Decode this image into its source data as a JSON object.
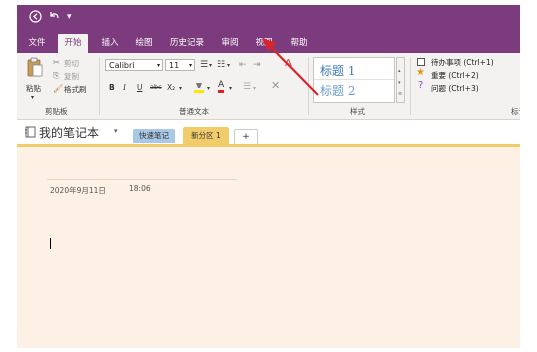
{
  "titlebar": {
    "back_icon": "back-circle-icon",
    "undo_icon": "undo-icon",
    "customize_icon": "customize-toolbar-icon"
  },
  "tabs": [
    "文件",
    "开始",
    "插入",
    "绘图",
    "历史记录",
    "审阅",
    "视图",
    "帮助"
  ],
  "active_tab": "开始",
  "clipboard": {
    "paste": "粘贴",
    "cut": "剪切",
    "copy": "复制",
    "format_painter": "格式刷",
    "group_label": "剪贴板"
  },
  "basic_text": {
    "font": "Calibri",
    "size": "11",
    "bold": "B",
    "italic": "I",
    "underline": "U",
    "strikethrough": "abc",
    "subscript": "X₂",
    "font_color": "A",
    "group_label": "普通文本"
  },
  "styles": {
    "heading1": "标题 1",
    "heading2": "标题 2",
    "group_label": "样式"
  },
  "tags": {
    "todo": "待办事项 (Ctrl+1)",
    "important": "重要 (Ctrl+2)",
    "question": "问题 (Ctrl+3)",
    "group_label": "标记"
  },
  "notebook": {
    "title": "我的笔记本",
    "sections": [
      "快速笔记",
      "新分区 1"
    ],
    "active_section": "新分区 1",
    "add_label": "+"
  },
  "page": {
    "date": "2020年9月11日",
    "time": "18:06"
  },
  "colors": {
    "accent": "#7b3b7c",
    "section_blue": "#a8c8e8",
    "section_gold": "#f0cc6b",
    "page_bg": "#fdf1e5",
    "annotation_arrow": "#d9242b"
  }
}
